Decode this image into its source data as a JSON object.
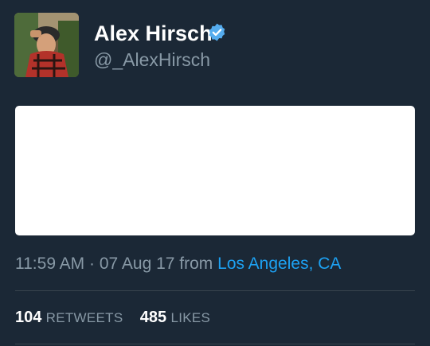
{
  "author": {
    "display_name": "Alex Hirsch",
    "handle": "@_AlexHirsch",
    "verified": true,
    "avatar_icon": "profile-photo"
  },
  "tweet": {
    "time": "11:59 AM",
    "separator": "·",
    "date": "07 Aug 17",
    "from_label": "from",
    "location": "Los Angeles, CA"
  },
  "stats": {
    "retweets_count": "104",
    "retweets_label": "RETWEETS",
    "likes_count": "485",
    "likes_label": "LIKES"
  },
  "colors": {
    "background": "#1b2836",
    "text_primary": "#ffffff",
    "text_secondary": "#8899a6",
    "accent": "#1da1f2",
    "verified_badge": "#55acee"
  }
}
